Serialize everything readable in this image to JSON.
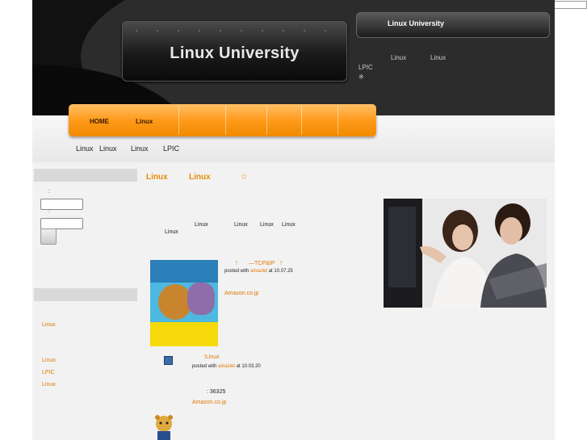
{
  "header": {
    "logo_text": "Linux University",
    "side_title": "Linux University",
    "links": [
      "Linux",
      "Linux",
      "LPIC",
      "※"
    ]
  },
  "nav": {
    "items": [
      "HOME",
      "Linux"
    ]
  },
  "breadcrumb": {
    "items": [
      "Linux",
      "Linux",
      "Linux",
      "LPIC"
    ]
  },
  "sidebar": {
    "colon1": ":",
    "colon2": ":",
    "link1": "Linux",
    "links": [
      "Linux",
      "LPIC",
      "Linux"
    ]
  },
  "main": {
    "title_parts": [
      "Linux",
      "Linux",
      "☆"
    ],
    "intro_words": [
      "Linux",
      "Linux",
      "Linux",
      "Linux",
      "Linux"
    ],
    "book1": {
      "label": "!　　—TCP&IP　!",
      "posted_with": "posted with",
      "poster": "amazlet",
      "at": "at 10.07.25",
      "store": "Amazon.co.jp"
    },
    "book2": {
      "label": "!Linux",
      "posted_with": "posted with",
      "poster": "amazlet",
      "at": "at 10.03.20",
      "rank": ": 36325",
      "store": "Amazon.co.jp"
    }
  },
  "colors": {
    "accent": "#e07800",
    "nav_orange": "#ff9a1a",
    "header_dark": "#111111"
  }
}
